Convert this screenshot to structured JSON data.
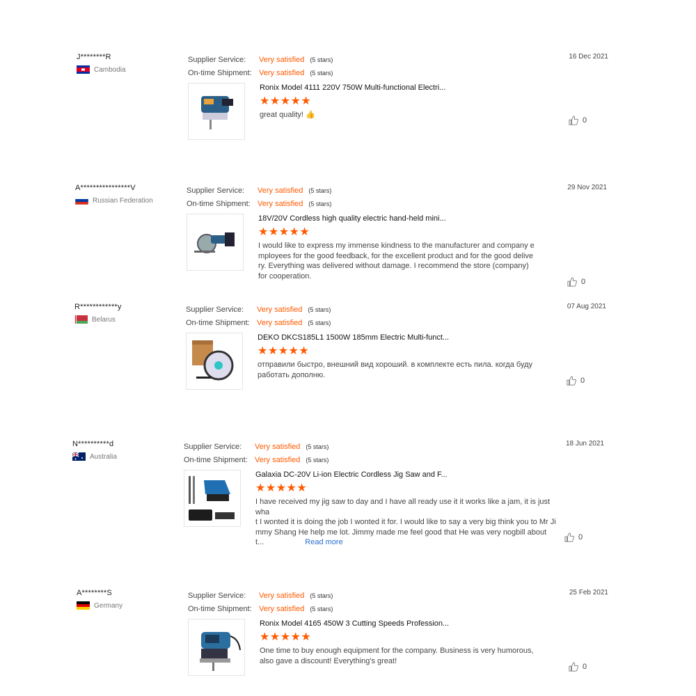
{
  "labels": {
    "supplier_service": "Supplier Service:",
    "on_time_shipment": "On-time Shipment:"
  },
  "icons": {
    "like": "thumbs-up-outline-icon",
    "star": "star-icon",
    "thumbs_emoji": "thumbs-up-emoji-icon"
  },
  "accent_color": "#ff5a00",
  "reviews": [
    {
      "user": "J********R",
      "country": "Cambodia",
      "supplier_value": "Very satisfied",
      "supplier_stars": "(5 stars)",
      "shipment_value": "Very satisfied",
      "shipment_stars": "(5 stars)",
      "date": "16 Dec 2021",
      "product_title": "Ronix Model 4111 220V 750W Multi-functional Electri...",
      "stars": "★★★★★",
      "rating": 5,
      "comment": "great quality! 👍",
      "likes": "0"
    },
    {
      "user": "A****************V",
      "country": "Russian Federation",
      "supplier_value": "Very satisfied",
      "supplier_stars": "(5 stars)",
      "shipment_value": "Very satisfied",
      "shipment_stars": "(5 stars)",
      "date": "29 Nov 2021",
      "product_title": "18V/20V Cordless high quality electric hand-held mini...",
      "stars": "★★★★★",
      "rating": 5,
      "comment_lines": [
        "I would like to express my immense kindness to the manufacturer and company e",
        "mployees for the good feedback, for the excellent product and for the good delive",
        "ry.  Everything was delivered without damage.  I recommend the store (company)",
        "for cooperation."
      ],
      "likes": "0"
    },
    {
      "user": "R************y",
      "country": "Belarus",
      "supplier_value": "Very satisfied",
      "supplier_stars": "(5 stars)",
      "shipment_value": "Very satisfied",
      "shipment_stars": "(5 stars)",
      "date": "07 Aug 2021",
      "product_title": "DEKO DKCS185L1 1500W 185mm Electric Multi-funct...",
      "stars": "★★★★★",
      "rating": 5,
      "comment_lines": [
        "отправили быстро, внешний вид хороший. в комплекте есть пила. когда буду",
        "работать дополню."
      ],
      "likes": "0"
    },
    {
      "user": "N**********d",
      "country": "Australia",
      "supplier_value": "Very satisfied",
      "supplier_stars": "(5 stars)",
      "shipment_value": "Very satisfied",
      "shipment_stars": "(5 stars)",
      "date": "18 Jun 2021",
      "product_title": "Galaxia DC-20V Li-ion Electric Cordless Jig Saw and F...",
      "stars": "★★★★★",
      "rating": 5,
      "comment_lines": [
        "I have received  my jig saw to day and I have all ready use it it works like a jam, it is just wha",
        "t I wonted it is doing the job I wonted it for.    I would like to say a very big think you to Mr Ji",
        "mmy Shang He help me lot. Jimmy made me feel good that He was very nogbill about"
      ],
      "comment_last": "t...",
      "read_more": "Read more",
      "likes": "0"
    },
    {
      "user": "A********S",
      "country": "Germany",
      "supplier_value": "Very satisfied",
      "supplier_stars": "(5 stars)",
      "shipment_value": "Very satisfied",
      "shipment_stars": "(5 stars)",
      "date": "25 Feb 2021",
      "product_title": "Ronix Model 4165 450W 3 Cutting Speeds Profession...",
      "stars": "★★★★★",
      "rating": 5,
      "comment_lines": [
        "One time to buy enough equipment for the company. Business is very humorous,",
        "also gave a discount! Everything's great!"
      ],
      "likes": "0"
    }
  ]
}
